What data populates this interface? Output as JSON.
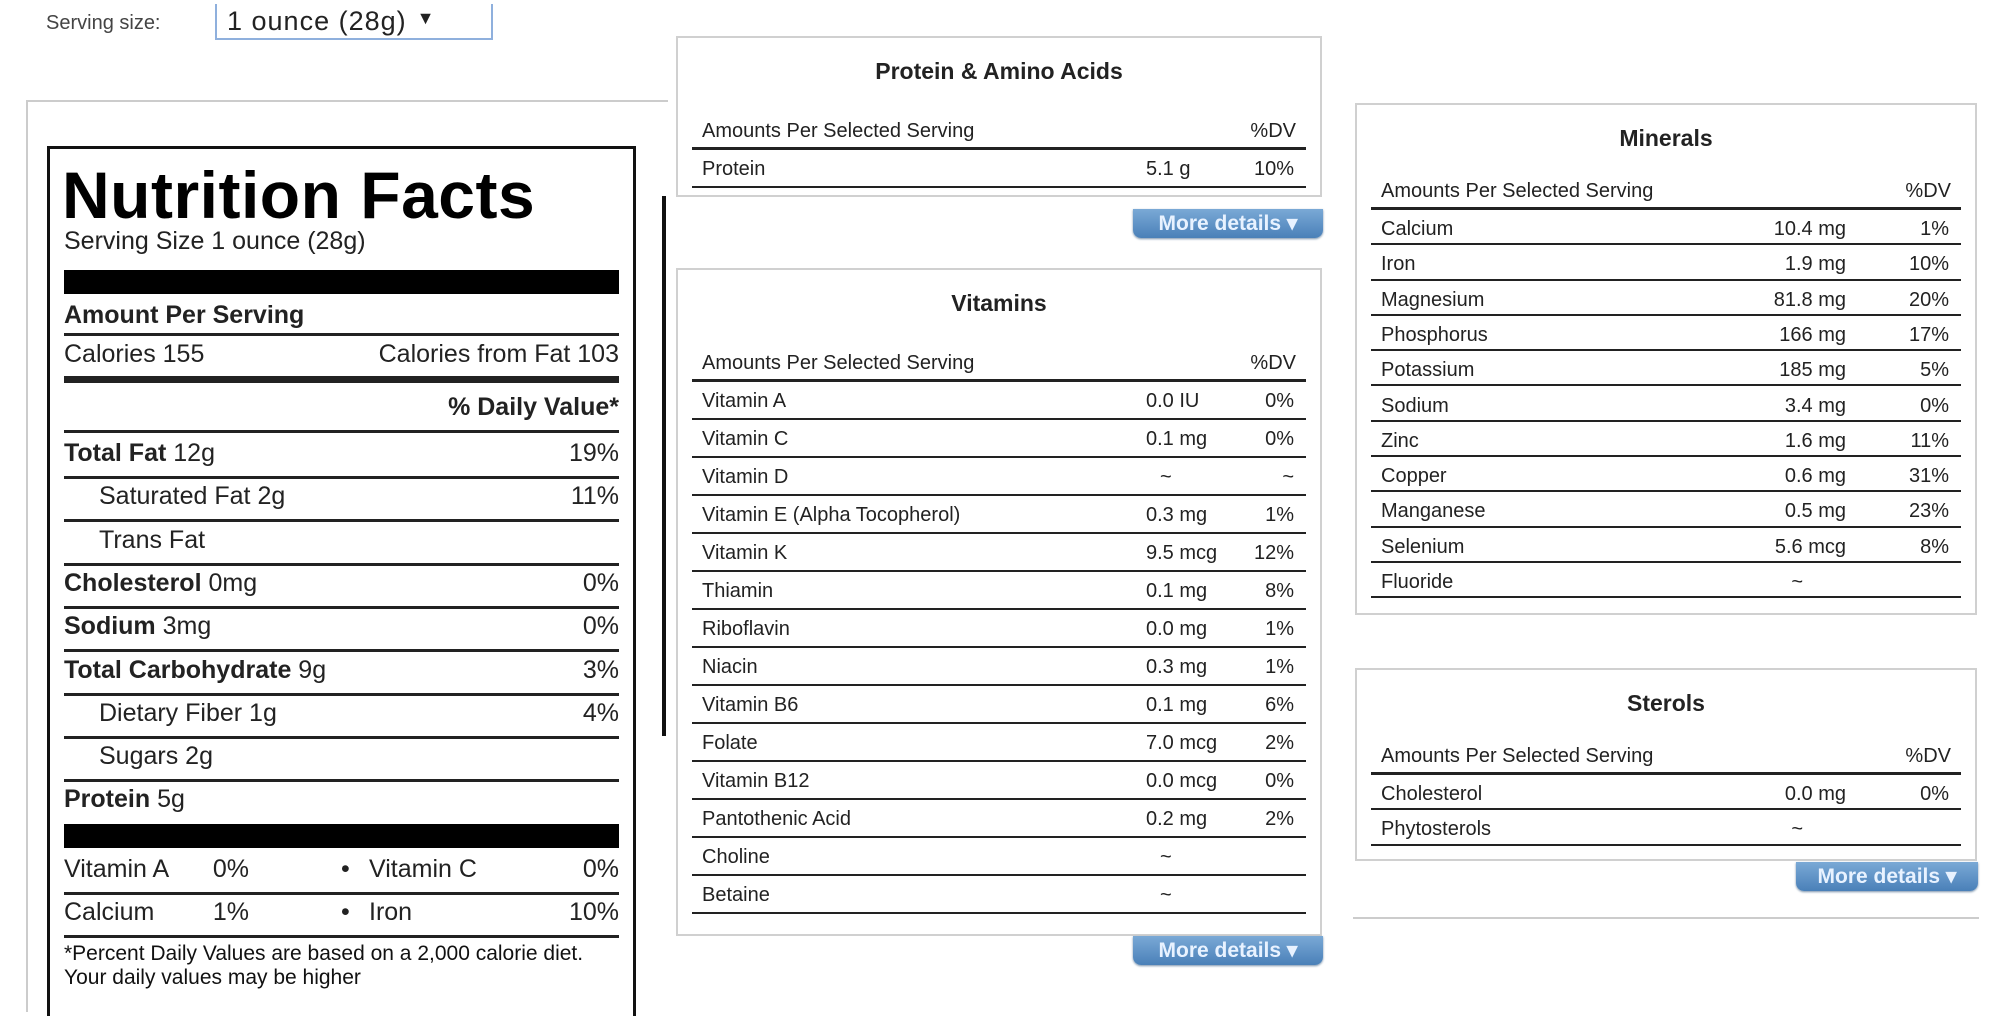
{
  "serving": {
    "label": "Serving size:",
    "selected": "1 ounce (28g)",
    "arrow": "▼"
  },
  "label": {
    "title": "Nutrition Facts",
    "serving_size": "Serving Size  1 ounce (28g)",
    "amount_per_serving": "Amount Per Serving",
    "calories": "Calories 155",
    "calories_from_fat": "Calories from Fat 103",
    "daily_value_header": "% Daily Value*",
    "rows": [
      {
        "name": "Total Fat",
        "amount": "12g",
        "dv": "19%",
        "bold": true,
        "indent": false
      },
      {
        "name": "Saturated Fat",
        "amount": "2g",
        "dv": "11%",
        "bold": false,
        "indent": true
      },
      {
        "name": "Trans Fat",
        "amount": "",
        "dv": "",
        "bold": false,
        "indent": true
      },
      {
        "name": "Cholesterol",
        "amount": "0mg",
        "dv": "0%",
        "bold": true,
        "indent": false
      },
      {
        "name": "Sodium",
        "amount": "3mg",
        "dv": "0%",
        "bold": true,
        "indent": false
      },
      {
        "name": "Total Carbohydrate",
        "amount": "9g",
        "dv": "3%",
        "bold": true,
        "indent": false
      },
      {
        "name": "Dietary Fiber",
        "amount": "1g",
        "dv": "4%",
        "bold": false,
        "indent": true
      },
      {
        "name": "Sugars",
        "amount": "2g",
        "dv": "",
        "bold": false,
        "indent": true
      },
      {
        "name": "Protein",
        "amount": "5g",
        "dv": "",
        "bold": true,
        "indent": false
      }
    ],
    "vitamins_line1": {
      "a_name": "Vitamin A",
      "a_dv": "0%",
      "sep": "•",
      "b_name": "Vitamin C",
      "b_dv": "0%"
    },
    "vitamins_line2": {
      "a_name": "Calcium",
      "a_dv": "1%",
      "sep": "•",
      "b_name": "Iron",
      "b_dv": "10%"
    },
    "footnote": "*Percent Daily Values are based on a 2,000 calorie diet. Your daily values may be higher"
  },
  "header_left": "Amounts Per Selected Serving",
  "header_right": "%DV",
  "more_details": "More details ▾",
  "protein": {
    "title": "Protein & Amino Acids",
    "rows": [
      {
        "name": "Protein",
        "amount": "5.1 g",
        "dv": "10%"
      }
    ]
  },
  "vitamins": {
    "title": "Vitamins",
    "rows": [
      {
        "name": "Vitamin A",
        "amount": "0.0 IU",
        "dv": "0%"
      },
      {
        "name": "Vitamin C",
        "amount": "0.1 mg",
        "dv": "0%"
      },
      {
        "name": "Vitamin D",
        "amount": "~",
        "dv": "~"
      },
      {
        "name": "Vitamin E (Alpha Tocopherol)",
        "amount": "0.3 mg",
        "dv": "1%"
      },
      {
        "name": "Vitamin K",
        "amount": "9.5 mcg",
        "dv": "12%"
      },
      {
        "name": "Thiamin",
        "amount": "0.1 mg",
        "dv": "8%"
      },
      {
        "name": "Riboflavin",
        "amount": "0.0 mg",
        "dv": "1%"
      },
      {
        "name": "Niacin",
        "amount": "0.3 mg",
        "dv": "1%"
      },
      {
        "name": "Vitamin B6",
        "amount": "0.1 mg",
        "dv": "6%"
      },
      {
        "name": "Folate",
        "amount": "7.0 mcg",
        "dv": "2%"
      },
      {
        "name": "Vitamin B12",
        "amount": "0.0 mcg",
        "dv": "0%"
      },
      {
        "name": "Pantothenic Acid",
        "amount": "0.2 mg",
        "dv": "2%"
      },
      {
        "name": "Choline",
        "amount": "~",
        "dv": ""
      },
      {
        "name": "Betaine",
        "amount": "~",
        "dv": ""
      }
    ]
  },
  "minerals": {
    "title": "Minerals",
    "rows": [
      {
        "name": "Calcium",
        "amount": "10.4 mg",
        "dv": "1%"
      },
      {
        "name": "Iron",
        "amount": "1.9 mg",
        "dv": "10%"
      },
      {
        "name": "Magnesium",
        "amount": "81.8 mg",
        "dv": "20%"
      },
      {
        "name": "Phosphorus",
        "amount": "166 mg",
        "dv": "17%"
      },
      {
        "name": "Potassium",
        "amount": "185 mg",
        "dv": "5%"
      },
      {
        "name": "Sodium",
        "amount": "3.4 mg",
        "dv": "0%"
      },
      {
        "name": "Zinc",
        "amount": "1.6 mg",
        "dv": "11%"
      },
      {
        "name": "Copper",
        "amount": "0.6 mg",
        "dv": "31%"
      },
      {
        "name": "Manganese",
        "amount": "0.5 mg",
        "dv": "23%"
      },
      {
        "name": "Selenium",
        "amount": "5.6 mcg",
        "dv": "8%"
      },
      {
        "name": "Fluoride",
        "amount": "~",
        "dv": ""
      }
    ]
  },
  "sterols": {
    "title": "Sterols",
    "rows": [
      {
        "name": "Cholesterol",
        "amount": "0.0 mg",
        "dv": "0%"
      },
      {
        "name": "Phytosterols",
        "amount": "~",
        "dv": ""
      }
    ]
  },
  "colors": {
    "button_top": "#7aa9d6",
    "button_bottom": "#4a80b8",
    "select_border": "#8fb0dd"
  }
}
